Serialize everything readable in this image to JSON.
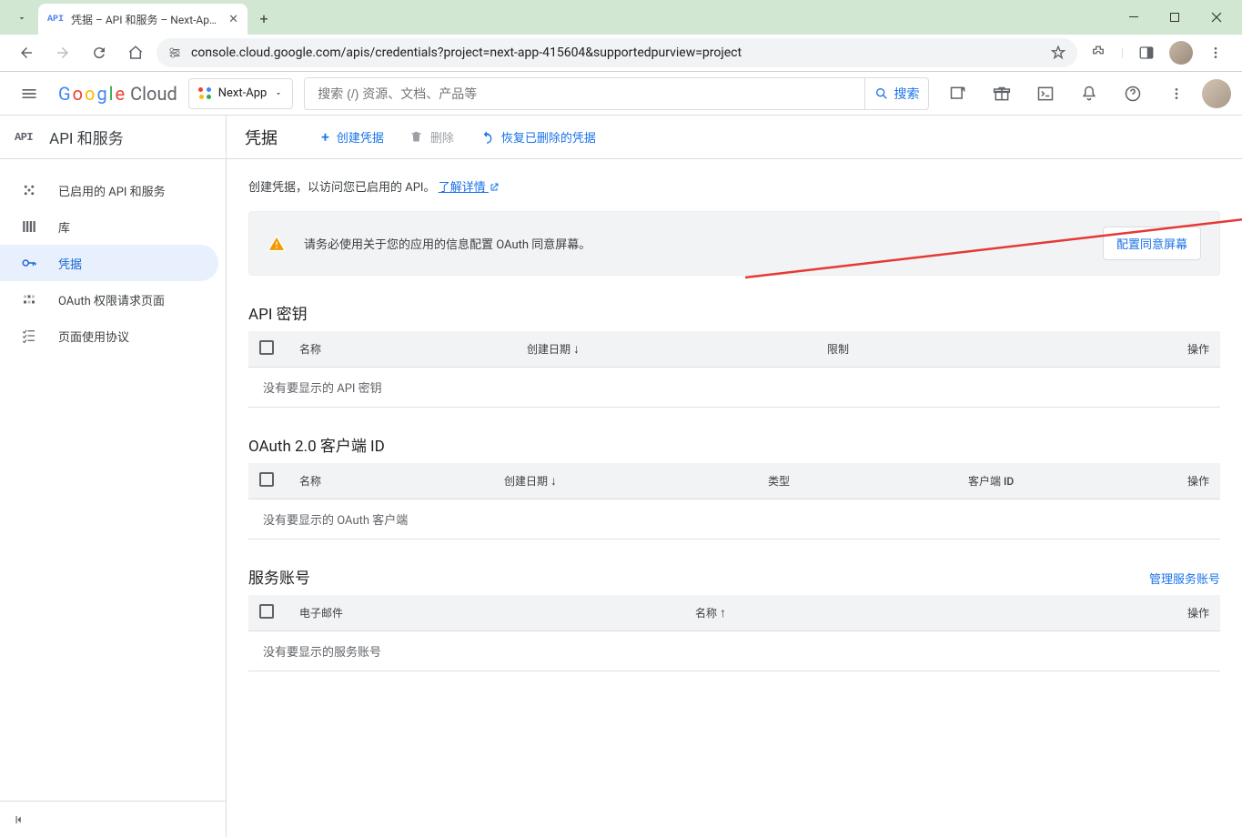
{
  "browser": {
    "tab_title": "凭据 – API 和服务 – Next-App…",
    "url": "console.cloud.google.com/apis/credentials?project=next-app-415604&supportedpurview=project"
  },
  "header": {
    "logo_cloud": "Cloud",
    "project": "Next-App",
    "search_placeholder": "搜索 (/) 资源、文档、产品等",
    "search_btn": "搜索"
  },
  "sidebar": {
    "title": "API 和服务",
    "items": [
      {
        "label": "已启用的 API 和服务"
      },
      {
        "label": "库"
      },
      {
        "label": "凭据"
      },
      {
        "label": "OAuth 权限请求页面"
      },
      {
        "label": "页面使用协议"
      }
    ]
  },
  "main": {
    "title": "凭据",
    "actions": {
      "create": "创建凭据",
      "delete": "删除",
      "restore": "恢复已删除的凭据"
    },
    "desc_text": "创建凭据，以访问您已启用的 API。",
    "desc_link": "了解详情",
    "banner_text": "请务必使用关于您的应用的信息配置 OAuth 同意屏幕。",
    "banner_btn": "配置同意屏幕"
  },
  "tables": {
    "api_keys": {
      "title": "API 密钥",
      "cols": {
        "name": "名称",
        "created": "创建日期",
        "restrict": "限制",
        "actions": "操作"
      },
      "empty": "没有要显示的 API 密钥"
    },
    "oauth": {
      "title": "OAuth 2.0 客户端 ID",
      "cols": {
        "name": "名称",
        "created": "创建日期",
        "type": "类型",
        "client_id": "客户端 ID",
        "actions": "操作"
      },
      "empty": "没有要显示的 OAuth 客户端"
    },
    "service": {
      "title": "服务账号",
      "link": "管理服务账号",
      "cols": {
        "email": "电子邮件",
        "name": "名称",
        "actions": "操作"
      },
      "empty": "没有要显示的服务账号"
    }
  }
}
